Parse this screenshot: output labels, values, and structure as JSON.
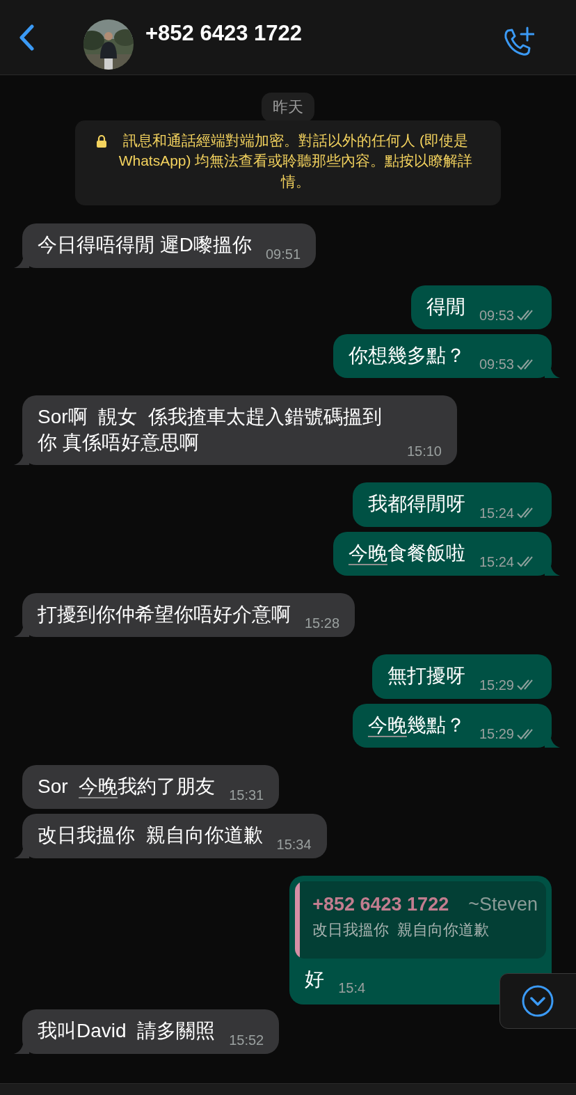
{
  "header": {
    "title": "+852 6423 1722"
  },
  "date_divider": "昨天",
  "encryption_notice": "訊息和通話經端對端加密。對話以外的任何人 (即使是 WhatsApp) 均無法查看或聆聽那些內容。點按以瞭解詳情。",
  "messages": [
    {
      "kind": "incoming",
      "parts": [
        {
          "text": "今日得唔得閒 遲D嚟搵你",
          "underlined": false
        }
      ],
      "time": "09:51",
      "tail": true
    },
    {
      "kind": "outgoing",
      "parts": [
        {
          "text": "得閒",
          "underlined": false
        }
      ],
      "time": "09:53",
      "delivered": true,
      "tail": false
    },
    {
      "kind": "outgoing",
      "parts": [
        {
          "text": "你想幾多點？",
          "underlined": false
        }
      ],
      "time": "09:53",
      "delivered": true,
      "tail": true
    },
    {
      "kind": "incoming",
      "parts": [
        {
          "text": "Sor啊  靚女  係我揸車太趕入錯號碼搵到你 真係唔好意思啊",
          "underlined": false
        }
      ],
      "time": "15:10",
      "tail": true
    },
    {
      "kind": "outgoing",
      "parts": [
        {
          "text": "我都得閒呀",
          "underlined": false
        }
      ],
      "time": "15:24",
      "delivered": true,
      "tail": false
    },
    {
      "kind": "outgoing",
      "parts": [
        {
          "text": "今晚",
          "underlined": true
        },
        {
          "text": "食餐飯啦",
          "underlined": false
        }
      ],
      "time": "15:24",
      "delivered": true,
      "tail": true
    },
    {
      "kind": "incoming",
      "parts": [
        {
          "text": "打擾到你仲希望你唔好介意啊",
          "underlined": false
        }
      ],
      "time": "15:28",
      "tail": true
    },
    {
      "kind": "outgoing",
      "parts": [
        {
          "text": "無打擾呀",
          "underlined": false
        }
      ],
      "time": "15:29",
      "delivered": true,
      "tail": false
    },
    {
      "kind": "outgoing",
      "parts": [
        {
          "text": "今晚",
          "underlined": true
        },
        {
          "text": "幾點？",
          "underlined": false
        }
      ],
      "time": "15:29",
      "delivered": true,
      "tail": true
    },
    {
      "kind": "incoming",
      "parts": [
        {
          "text": "Sor  ",
          "underlined": false
        },
        {
          "text": "今晚",
          "underlined": true
        },
        {
          "text": "我約了朋友",
          "underlined": false
        }
      ],
      "time": "15:31",
      "tail": false
    },
    {
      "kind": "incoming",
      "parts": [
        {
          "text": "改日我搵你  親自向你道歉",
          "underlined": false
        }
      ],
      "time": "15:34",
      "tail": true
    },
    {
      "kind": "outgoing",
      "quote": {
        "sender": "+852 6423 1722",
        "alias": "~Steven",
        "text": "改日我搵你  親自向你道歉"
      },
      "parts": [
        {
          "text": "好",
          "underlined": false
        }
      ],
      "time": "15:4",
      "tail": false
    },
    {
      "kind": "incoming",
      "parts": [
        {
          "text": "我叫David  請多關照",
          "underlined": false
        }
      ],
      "time": "15:52",
      "tail": true
    }
  ]
}
